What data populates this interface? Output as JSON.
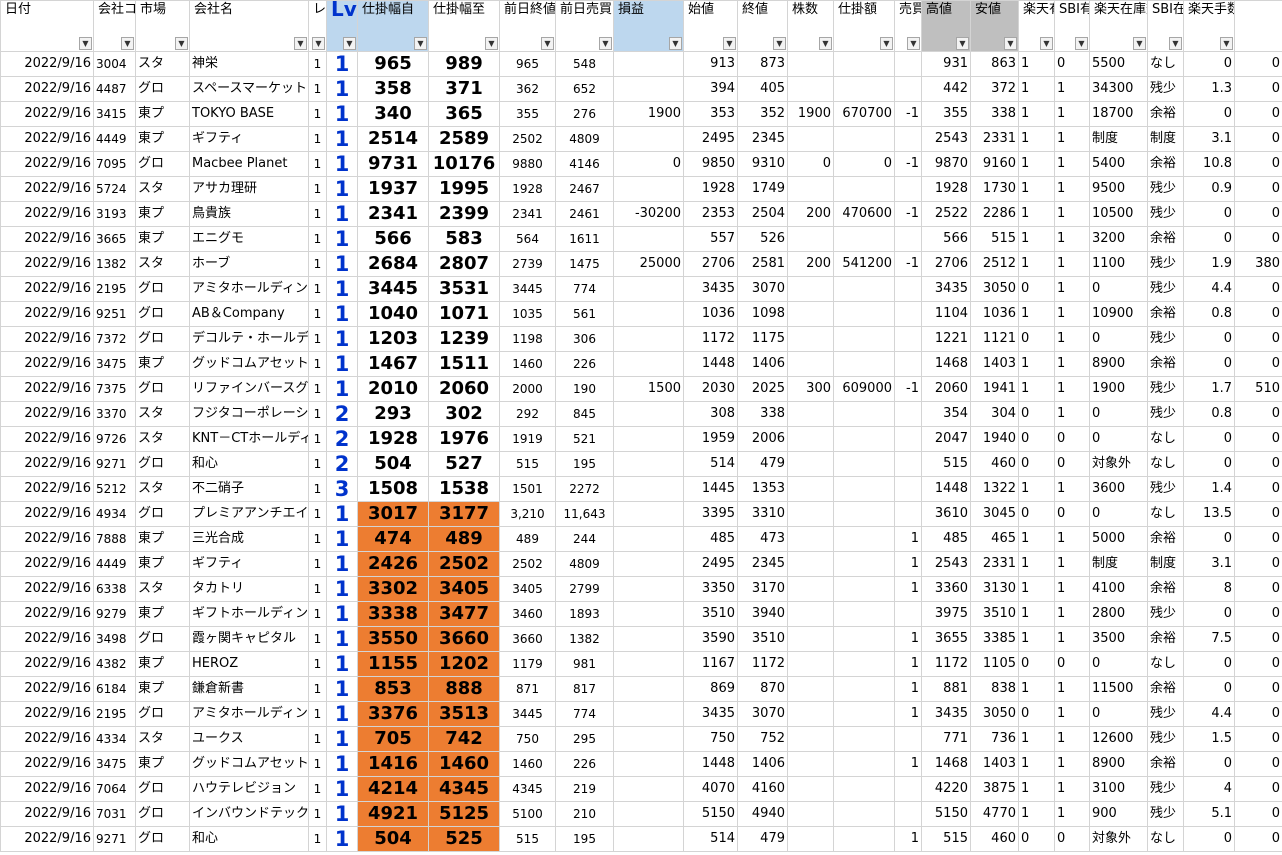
{
  "headers": [
    {
      "label": "日付",
      "cls": ""
    },
    {
      "label": "会社コード",
      "cls": ""
    },
    {
      "label": "市場",
      "cls": ""
    },
    {
      "label": "会社名",
      "cls": ""
    },
    {
      "label": "レ",
      "cls": ""
    },
    {
      "label": "Lv",
      "cls": "blue lv"
    },
    {
      "label": "仕掛幅自",
      "cls": "blue"
    },
    {
      "label": "仕掛幅至",
      "cls": ""
    },
    {
      "label": "前日終値",
      "cls": ""
    },
    {
      "label": "前日売買(百万円)",
      "cls": ""
    },
    {
      "label": "損益",
      "cls": "blue"
    },
    {
      "label": "始値",
      "cls": ""
    },
    {
      "label": "終値",
      "cls": ""
    },
    {
      "label": "株数",
      "cls": ""
    },
    {
      "label": "仕掛額",
      "cls": ""
    },
    {
      "label": "売買",
      "cls": ""
    },
    {
      "label": "高値",
      "cls": "gray"
    },
    {
      "label": "安値",
      "cls": "gray"
    },
    {
      "label": "楽天有無",
      "cls": ""
    },
    {
      "label": "SBI有無",
      "cls": ""
    },
    {
      "label": "楽天在庫数",
      "cls": ""
    },
    {
      "label": "SBI在庫数",
      "cls": ""
    },
    {
      "label": "楽天手数料",
      "cls": ""
    },
    {
      "label": "",
      "cls": ""
    }
  ],
  "rows": [
    [
      "2022/9/16",
      "3004",
      "スタ",
      "神栄",
      "1",
      "1",
      "965",
      "989",
      "965",
      "548",
      "",
      "913",
      "873",
      "",
      "",
      "",
      "931",
      "863",
      "1",
      "0",
      "5500",
      "なし",
      "0",
      "0"
    ],
    [
      "2022/9/16",
      "4487",
      "グロ",
      "スペースマーケット",
      "1",
      "1",
      "358",
      "371",
      "362",
      "652",
      "",
      "394",
      "405",
      "",
      "",
      "",
      "442",
      "372",
      "1",
      "1",
      "34300",
      "残少",
      "1.3",
      "0"
    ],
    [
      "2022/9/16",
      "3415",
      "東プ",
      "TOKYO BASE",
      "1",
      "1",
      "340",
      "365",
      "355",
      "276",
      "1900",
      "353",
      "352",
      "1900",
      "670700",
      "-1",
      "355",
      "338",
      "1",
      "1",
      "18700",
      "余裕",
      "0",
      "0"
    ],
    [
      "2022/9/16",
      "4449",
      "東プ",
      "ギフティ",
      "1",
      "1",
      "2514",
      "2589",
      "2502",
      "4809",
      "",
      "2495",
      "2345",
      "",
      "",
      "",
      "2543",
      "2331",
      "1",
      "1",
      "制度",
      "制度",
      "3.1",
      "0"
    ],
    [
      "2022/9/16",
      "7095",
      "グロ",
      "Macbee Planet",
      "1",
      "1",
      "9731",
      "10176",
      "9880",
      "4146",
      "0",
      "9850",
      "9310",
      "0",
      "0",
      "-1",
      "9870",
      "9160",
      "1",
      "1",
      "5400",
      "余裕",
      "10.8",
      "0"
    ],
    [
      "2022/9/16",
      "5724",
      "スタ",
      "アサカ理研",
      "1",
      "1",
      "1937",
      "1995",
      "1928",
      "2467",
      "",
      "1928",
      "1749",
      "",
      "",
      "",
      "1928",
      "1730",
      "1",
      "1",
      "9500",
      "残少",
      "0.9",
      "0"
    ],
    [
      "2022/9/16",
      "3193",
      "東プ",
      "鳥貴族",
      "1",
      "1",
      "2341",
      "2399",
      "2341",
      "2461",
      "-30200",
      "2353",
      "2504",
      "200",
      "470600",
      "-1",
      "2522",
      "2286",
      "1",
      "1",
      "10500",
      "残少",
      "0",
      "0"
    ],
    [
      "2022/9/16",
      "3665",
      "東プ",
      "エニグモ",
      "1",
      "1",
      "566",
      "583",
      "564",
      "1611",
      "",
      "557",
      "526",
      "",
      "",
      "",
      "566",
      "515",
      "1",
      "1",
      "3200",
      "余裕",
      "0",
      "0"
    ],
    [
      "2022/9/16",
      "1382",
      "スタ",
      "ホーブ",
      "1",
      "1",
      "2684",
      "2807",
      "2739",
      "1475",
      "25000",
      "2706",
      "2581",
      "200",
      "541200",
      "-1",
      "2706",
      "2512",
      "1",
      "1",
      "1100",
      "残少",
      "1.9",
      "380"
    ],
    [
      "2022/9/16",
      "2195",
      "グロ",
      "アミタホールディングス",
      "1",
      "1",
      "3445",
      "3531",
      "3445",
      "774",
      "",
      "3435",
      "3070",
      "",
      "",
      "",
      "3435",
      "3050",
      "0",
      "1",
      "0",
      "残少",
      "4.4",
      "0"
    ],
    [
      "2022/9/16",
      "9251",
      "グロ",
      "AB＆Company",
      "1",
      "1",
      "1040",
      "1071",
      "1035",
      "561",
      "",
      "1036",
      "1098",
      "",
      "",
      "",
      "1104",
      "1036",
      "1",
      "1",
      "10900",
      "余裕",
      "0.8",
      "0"
    ],
    [
      "2022/9/16",
      "7372",
      "グロ",
      "デコルテ・ホールディングス",
      "1",
      "1",
      "1203",
      "1239",
      "1198",
      "306",
      "",
      "1172",
      "1175",
      "",
      "",
      "",
      "1221",
      "1121",
      "0",
      "1",
      "0",
      "残少",
      "0",
      "0"
    ],
    [
      "2022/9/16",
      "3475",
      "東プ",
      "グッドコムアセット",
      "1",
      "1",
      "1467",
      "1511",
      "1460",
      "226",
      "",
      "1448",
      "1406",
      "",
      "",
      "",
      "1468",
      "1403",
      "1",
      "1",
      "8900",
      "余裕",
      "0",
      "0"
    ],
    [
      "2022/9/16",
      "7375",
      "グロ",
      "リファインバースグループ",
      "1",
      "1",
      "2010",
      "2060",
      "2000",
      "190",
      "1500",
      "2030",
      "2025",
      "300",
      "609000",
      "-1",
      "2060",
      "1941",
      "1",
      "1",
      "1900",
      "残少",
      "1.7",
      "510"
    ],
    [
      "2022/9/16",
      "3370",
      "スタ",
      "フジタコーポレーション",
      "1",
      "2",
      "293",
      "302",
      "292",
      "845",
      "",
      "308",
      "338",
      "",
      "",
      "",
      "354",
      "304",
      "0",
      "1",
      "0",
      "残少",
      "0.8",
      "0"
    ],
    [
      "2022/9/16",
      "9726",
      "スタ",
      "KNT－CTホールディングス",
      "1",
      "2",
      "1928",
      "1976",
      "1919",
      "521",
      "",
      "1959",
      "2006",
      "",
      "",
      "",
      "2047",
      "1940",
      "0",
      "0",
      "0",
      "なし",
      "0",
      "0"
    ],
    [
      "2022/9/16",
      "9271",
      "グロ",
      "和心",
      "1",
      "2",
      "504",
      "527",
      "515",
      "195",
      "",
      "514",
      "479",
      "",
      "",
      "",
      "515",
      "460",
      "0",
      "0",
      "対象外",
      "なし",
      "0",
      "0"
    ],
    [
      "2022/9/16",
      "5212",
      "スタ",
      "不二硝子",
      "1",
      "3",
      "1508",
      "1538",
      "1501",
      "2272",
      "",
      "1445",
      "1353",
      "",
      "",
      "",
      "1448",
      "1322",
      "1",
      "1",
      "3600",
      "残少",
      "1.4",
      "0"
    ],
    [
      "2022/9/16",
      "4934",
      "グロ",
      "プレミアアンチエイジング",
      "1",
      "1",
      "3017",
      "3177",
      "3,210",
      "11,643",
      "",
      "3395",
      "3310",
      "",
      "",
      "",
      "3610",
      "3045",
      "0",
      "0",
      "0",
      "なし",
      "13.5",
      "0"
    ],
    [
      "2022/9/16",
      "7888",
      "東プ",
      "三光合成",
      "1",
      "1",
      "474",
      "489",
      "489",
      "244",
      "",
      "485",
      "473",
      "",
      "",
      "1",
      "485",
      "465",
      "1",
      "1",
      "5000",
      "余裕",
      "0",
      "0"
    ],
    [
      "2022/9/16",
      "4449",
      "東プ",
      "ギフティ",
      "1",
      "1",
      "2426",
      "2502",
      "2502",
      "4809",
      "",
      "2495",
      "2345",
      "",
      "",
      "1",
      "2543",
      "2331",
      "1",
      "1",
      "制度",
      "制度",
      "3.1",
      "0"
    ],
    [
      "2022/9/16",
      "6338",
      "スタ",
      "タカトリ",
      "1",
      "1",
      "3302",
      "3405",
      "3405",
      "2799",
      "",
      "3350",
      "3170",
      "",
      "",
      "1",
      "3360",
      "3130",
      "1",
      "1",
      "4100",
      "余裕",
      "8",
      "0"
    ],
    [
      "2022/9/16",
      "9279",
      "東プ",
      "ギフトホールディングス",
      "1",
      "1",
      "3338",
      "3477",
      "3460",
      "1893",
      "",
      "3510",
      "3940",
      "",
      "",
      "",
      "3975",
      "3510",
      "1",
      "1",
      "2800",
      "残少",
      "0",
      "0"
    ],
    [
      "2022/9/16",
      "3498",
      "グロ",
      "霞ヶ関キャピタル",
      "1",
      "1",
      "3550",
      "3660",
      "3660",
      "1382",
      "",
      "3590",
      "3510",
      "",
      "",
      "1",
      "3655",
      "3385",
      "1",
      "1",
      "3500",
      "余裕",
      "7.5",
      "0"
    ],
    [
      "2022/9/16",
      "4382",
      "東プ",
      "HEROZ",
      "1",
      "1",
      "1155",
      "1202",
      "1179",
      "981",
      "",
      "1167",
      "1172",
      "",
      "",
      "1",
      "1172",
      "1105",
      "0",
      "0",
      "0",
      "なし",
      "0",
      "0"
    ],
    [
      "2022/9/16",
      "6184",
      "東プ",
      "鎌倉新書",
      "1",
      "1",
      "853",
      "888",
      "871",
      "817",
      "",
      "869",
      "870",
      "",
      "",
      "1",
      "881",
      "838",
      "1",
      "1",
      "11500",
      "余裕",
      "0",
      "0"
    ],
    [
      "2022/9/16",
      "2195",
      "グロ",
      "アミタホールディングス",
      "1",
      "1",
      "3376",
      "3513",
      "3445",
      "774",
      "",
      "3435",
      "3070",
      "",
      "",
      "1",
      "3435",
      "3050",
      "0",
      "1",
      "0",
      "残少",
      "4.4",
      "0"
    ],
    [
      "2022/9/16",
      "4334",
      "スタ",
      "ユークス",
      "1",
      "1",
      "705",
      "742",
      "750",
      "295",
      "",
      "750",
      "752",
      "",
      "",
      "",
      "771",
      "736",
      "1",
      "1",
      "12600",
      "残少",
      "1.5",
      "0"
    ],
    [
      "2022/9/16",
      "3475",
      "東プ",
      "グッドコムアセット",
      "1",
      "1",
      "1416",
      "1460",
      "1460",
      "226",
      "",
      "1448",
      "1406",
      "",
      "",
      "1",
      "1468",
      "1403",
      "1",
      "1",
      "8900",
      "余裕",
      "0",
      "0"
    ],
    [
      "2022/9/16",
      "7064",
      "グロ",
      "ハウテレビジョン",
      "1",
      "1",
      "4214",
      "4345",
      "4345",
      "219",
      "",
      "4070",
      "4160",
      "",
      "",
      "",
      "4220",
      "3875",
      "1",
      "1",
      "3100",
      "残少",
      "4",
      "0"
    ],
    [
      "2022/9/16",
      "7031",
      "グロ",
      "インバウンドテック",
      "1",
      "1",
      "4921",
      "5125",
      "5100",
      "210",
      "",
      "5150",
      "4940",
      "",
      "",
      "",
      "5150",
      "4770",
      "1",
      "1",
      "900",
      "残少",
      "5.1",
      "0"
    ],
    [
      "2022/9/16",
      "9271",
      "グロ",
      "和心",
      "1",
      "1",
      "504",
      "525",
      "515",
      "195",
      "",
      "514",
      "479",
      "",
      "",
      "1",
      "515",
      "460",
      "0",
      "0",
      "対象外",
      "なし",
      "0",
      "0"
    ]
  ],
  "orange_from_row": 18
}
